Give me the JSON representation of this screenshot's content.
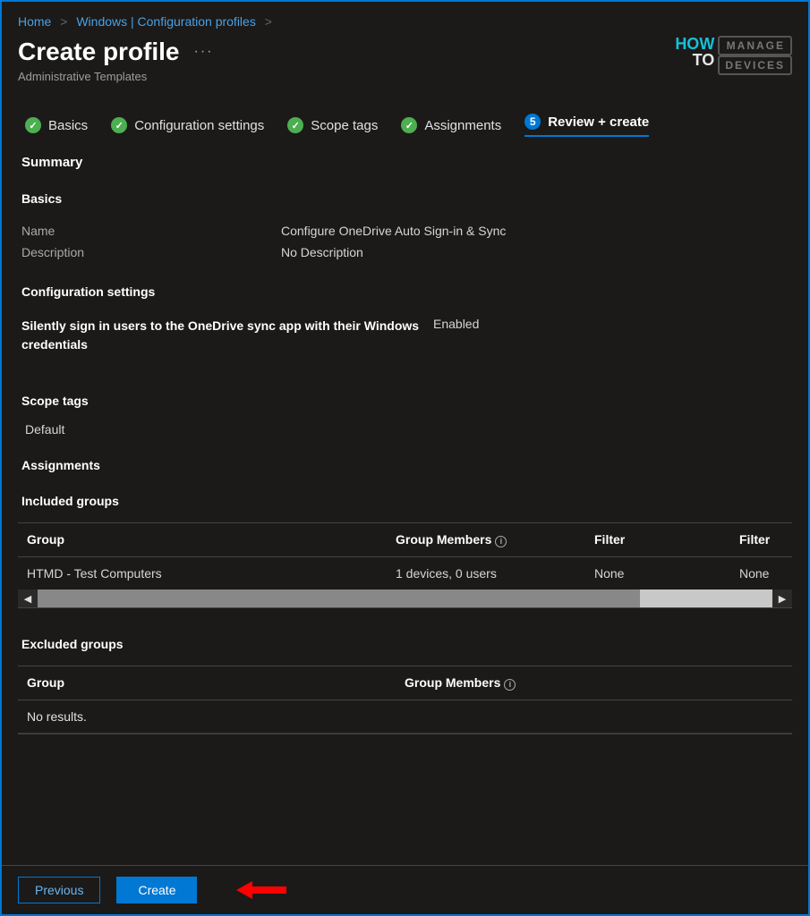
{
  "breadcrumb": {
    "items": [
      "Home",
      "Windows | Configuration profiles"
    ]
  },
  "header": {
    "title": "Create profile",
    "subtitle": "Administrative Templates"
  },
  "logo": {
    "l1": "HOW",
    "l2": "TO",
    "r1": "MANAGE",
    "r2": "DEVICES"
  },
  "steps": {
    "s1": "Basics",
    "s2": "Configuration settings",
    "s3": "Scope tags",
    "s4": "Assignments",
    "s5_num": "5",
    "s5": "Review + create"
  },
  "summary": {
    "heading": "Summary"
  },
  "basics": {
    "heading": "Basics",
    "name_label": "Name",
    "name_value": "Configure OneDrive Auto Sign-in & Sync",
    "desc_label": "Description",
    "desc_value": "No Description"
  },
  "config": {
    "heading": "Configuration settings",
    "setting_label": "Silently sign in users to the OneDrive sync app with their Windows credentials",
    "setting_value": "Enabled"
  },
  "scope": {
    "heading": "Scope tags",
    "value": "Default"
  },
  "assignments": {
    "heading": "Assignments"
  },
  "included": {
    "heading": "Included groups",
    "cols": {
      "c1": "Group",
      "c2": "Group Members",
      "c3": "Filter",
      "c4": "Filter"
    },
    "rows": [
      {
        "c1": "HTMD - Test Computers",
        "c2": "1 devices, 0 users",
        "c3": "None",
        "c4": "None"
      }
    ]
  },
  "excluded": {
    "heading": "Excluded groups",
    "cols": {
      "c1": "Group",
      "c2": "Group Members"
    },
    "empty": "No results."
  },
  "footer": {
    "previous": "Previous",
    "create": "Create"
  }
}
